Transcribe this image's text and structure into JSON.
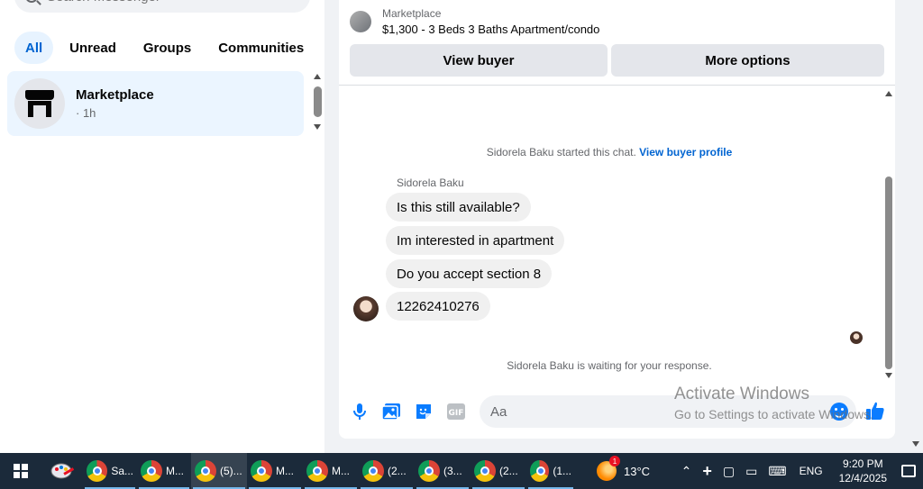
{
  "sidebar": {
    "search_placeholder": "Search Messenger",
    "filters": [
      "All",
      "Unread",
      "Groups",
      "Communities"
    ],
    "conversation": {
      "name": "Marketplace",
      "meta": "· 1h"
    }
  },
  "chat": {
    "listing_label": "Marketplace",
    "listing_title": "$1,300 - 3 Beds 3 Baths Apartment/condo",
    "view_buyer_label": "View buyer",
    "more_options_label": "More options",
    "started_text": "Sidorela Baku started this chat.",
    "view_profile_link": "View buyer profile",
    "sender_name": "Sidorela Baku",
    "messages": [
      "Is this still available?",
      "Im interested in apartment",
      "Do you accept section 8",
      "12262410276"
    ],
    "waiting_text": "Sidorela Baku is waiting for your response.",
    "composer_placeholder": "Aa",
    "accent_color": "#0a7cff"
  },
  "watermark": {
    "title": "Activate Windows",
    "subtitle": "Go to Settings to activate Windows."
  },
  "taskbar": {
    "apps": [
      "Sa...",
      "M...",
      "(5)...",
      "M...",
      "M...",
      "(2...",
      "(3...",
      "(2...",
      "(1..."
    ],
    "weather_temp": "13°C",
    "weather_badge": "1",
    "language": "ENG",
    "time": "9:20 PM",
    "date": "12/4/2025"
  }
}
